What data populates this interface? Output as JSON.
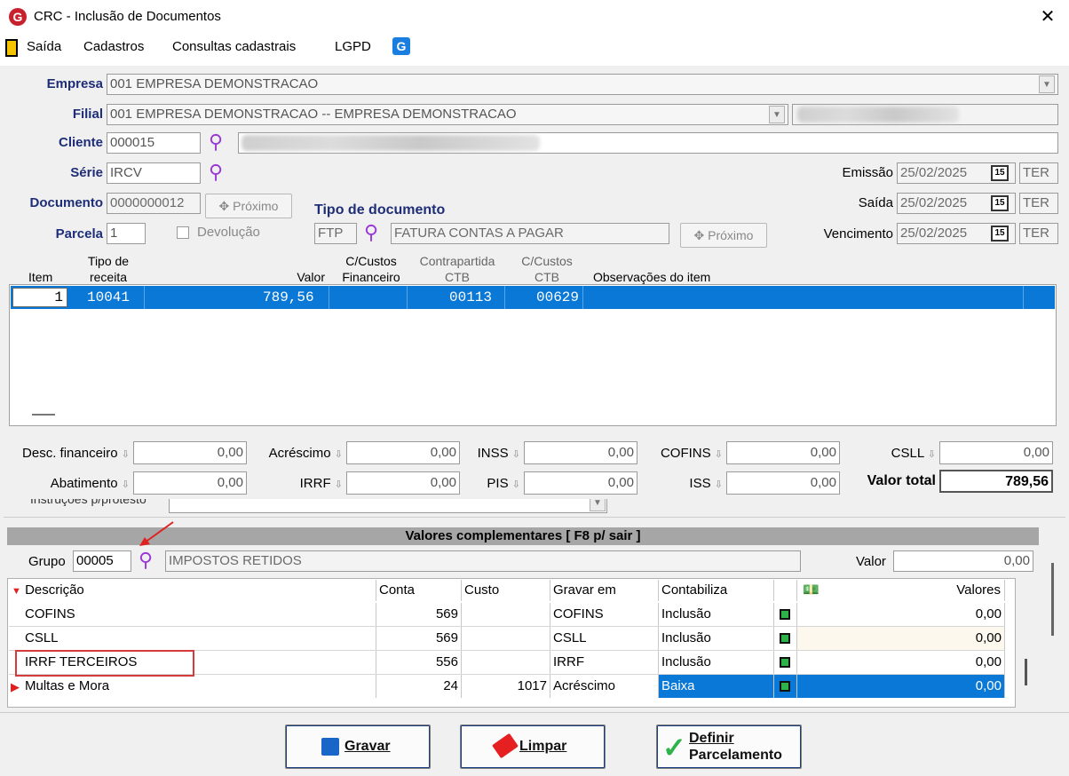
{
  "window": {
    "title": "CRC - Inclusão de Documentos",
    "logo": "G",
    "close": "✕"
  },
  "menu": {
    "items": [
      "Saída",
      "Cadastros",
      "Consultas cadastrais",
      "LGPD"
    ],
    "g_icon": "G"
  },
  "form": {
    "empresa": {
      "label": "Empresa",
      "value": "001 EMPRESA DEMONSTRACAO"
    },
    "filial": {
      "label": "Filial",
      "value": "001 EMPRESA DEMONSTRACAO -- EMPRESA DEMONSTRACAO"
    },
    "cliente": {
      "label": "Cliente",
      "value": "000015"
    },
    "serie": {
      "label": "Série",
      "value": "IRCV"
    },
    "documento": {
      "label": "Documento",
      "value": "0000000012",
      "next": "Próximo"
    },
    "parcela": {
      "label": "Parcela",
      "value": "1",
      "devolucao": "Devolução"
    },
    "tipo_doc": {
      "label": "Tipo de documento",
      "code": "FTP",
      "desc": "FATURA CONTAS A PAGAR",
      "next": "Próximo"
    },
    "emissao": {
      "label": "Emissão",
      "date": "25/02/2025",
      "day": "TER"
    },
    "saida": {
      "label": "Saída",
      "date": "25/02/2025",
      "day": "TER"
    },
    "vencimento": {
      "label": "Vencimento",
      "date": "25/02/2025",
      "day": "TER"
    },
    "cal_icon": "15"
  },
  "items_grid": {
    "headers": {
      "item": "Item",
      "tipo": [
        "Tipo de",
        "receita"
      ],
      "valor": "Valor",
      "ccfin": [
        "C/Custos",
        "Financeiro"
      ],
      "contra": [
        "Contrapartida",
        "CTB"
      ],
      "ccctb": [
        "C/Custos",
        "CTB"
      ],
      "obs": "Observações do item"
    },
    "row": {
      "item": "1",
      "tipo": "10041",
      "valor": "789,56",
      "contra": "00113",
      "ccctb": "00629"
    }
  },
  "totals": {
    "desc_fin": {
      "label": "Desc. financeiro",
      "value": "0,00"
    },
    "acrescimo": {
      "label": "Acréscimo",
      "value": "0,00"
    },
    "inss": {
      "label": "INSS",
      "value": "0,00"
    },
    "cofins": {
      "label": "COFINS",
      "value": "0,00"
    },
    "csll": {
      "label": "CSLL",
      "value": "0,00"
    },
    "abatimento": {
      "label": "Abatimento",
      "value": "0,00"
    },
    "irrf": {
      "label": "IRRF",
      "value": "0,00"
    },
    "pis": {
      "label": "PIS",
      "value": "0,00"
    },
    "iss": {
      "label": "ISS",
      "value": "0,00"
    },
    "valor_total": {
      "label": "Valor total",
      "value": "789,56"
    }
  },
  "instrucoes_label": "Instruções p/protesto",
  "complementares": {
    "title": "Valores complementares [ F8 p/ sair ]",
    "grupo_label": "Grupo",
    "grupo_value": "00005",
    "grupo_desc": "IMPOSTOS RETIDOS",
    "valor_label": "Valor",
    "valor_value": "0,00",
    "headers": {
      "descricao": "Descrição",
      "conta": "Conta",
      "custo": "Custo",
      "gravar": "Gravar em",
      "contabiliza": "Contabiliza",
      "valores": "Valores"
    },
    "rows": [
      {
        "descricao": "COFINS",
        "conta": "569",
        "custo": "",
        "gravar": "COFINS",
        "contabiliza": "Inclusão",
        "valores": "0,00"
      },
      {
        "descricao": "CSLL",
        "conta": "569",
        "custo": "",
        "gravar": "CSLL",
        "contabiliza": "Inclusão",
        "valores": "0,00"
      },
      {
        "descricao": "IRRF TERCEIROS",
        "conta": "556",
        "custo": "",
        "gravar": "IRRF",
        "contabiliza": "Inclusão",
        "valores": "0,00"
      },
      {
        "descricao": "Multas e Mora",
        "conta": "24",
        "custo": "1017",
        "gravar": "Acréscimo",
        "contabiliza": "Baixa",
        "valores": "0,00"
      }
    ]
  },
  "buttons": {
    "gravar": "Gravar",
    "limpar": "Limpar",
    "definir1": "Definir",
    "definir2": "Parcelamento"
  }
}
